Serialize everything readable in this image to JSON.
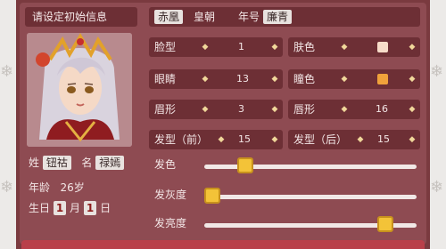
{
  "title": "请设定初始信息",
  "profile": {
    "surname_label": "姓",
    "surname": "钮祜",
    "given_label": "名",
    "given": "禄嫣",
    "age_label": "年龄",
    "age": "26岁",
    "birthday_label": "生日",
    "month": "1",
    "month_label": "月",
    "day": "1",
    "day_label": "日"
  },
  "dynasty": {
    "name": "赤凰",
    "suffix": "皇朝",
    "era_label": "年号",
    "era": "廉青"
  },
  "attributes": {
    "face": {
      "label": "脸型",
      "value": "1"
    },
    "skin": {
      "label": "肤色",
      "color": "#f7dcc9"
    },
    "eyes": {
      "label": "眼睛",
      "value": "13"
    },
    "pupil": {
      "label": "瞳色",
      "color": "#f0a23b"
    },
    "brow": {
      "label": "眉形",
      "value": "3"
    },
    "lip": {
      "label": "唇形",
      "value": "16"
    },
    "hair_front": {
      "label": "发型（前）",
      "value": "15"
    },
    "hair_back": {
      "label": "发型（后）",
      "value": "15"
    }
  },
  "sliders": {
    "hair_color": {
      "label": "发色",
      "level": 0.17
    },
    "hair_gray": {
      "label": "发灰度",
      "level": 0.0
    },
    "hair_bright": {
      "label": "发亮度",
      "level": 0.88
    }
  },
  "arrows": {
    "left": "◆",
    "right": "◆"
  },
  "colors": {
    "accent": "#f3c338",
    "panel": "#6d2f35",
    "bg": "#8e4b52"
  }
}
